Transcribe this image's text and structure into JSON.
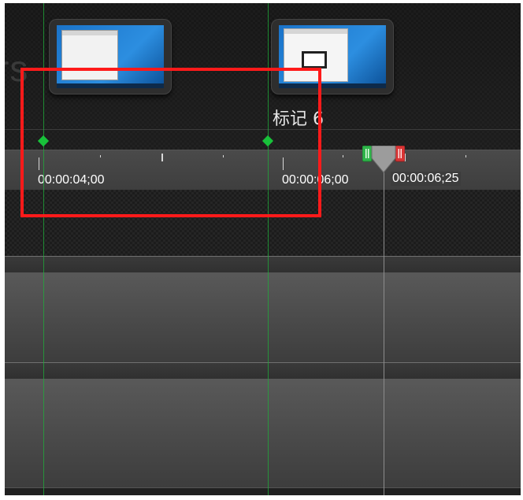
{
  "timeline": {
    "marker_label": "标记 6",
    "ghost_text": "rs",
    "time_labels": [
      "00:00:04;00",
      "00:00:06;00",
      "00:00:06;25"
    ]
  },
  "colors": {
    "marker": "#18c23a",
    "highlight_box": "#ff1a1a",
    "playhead_in": "#2fb54a",
    "playhead_out": "#d93434"
  },
  "icons": {
    "marker": "green-diamond",
    "playhead": "playhead-handle"
  }
}
